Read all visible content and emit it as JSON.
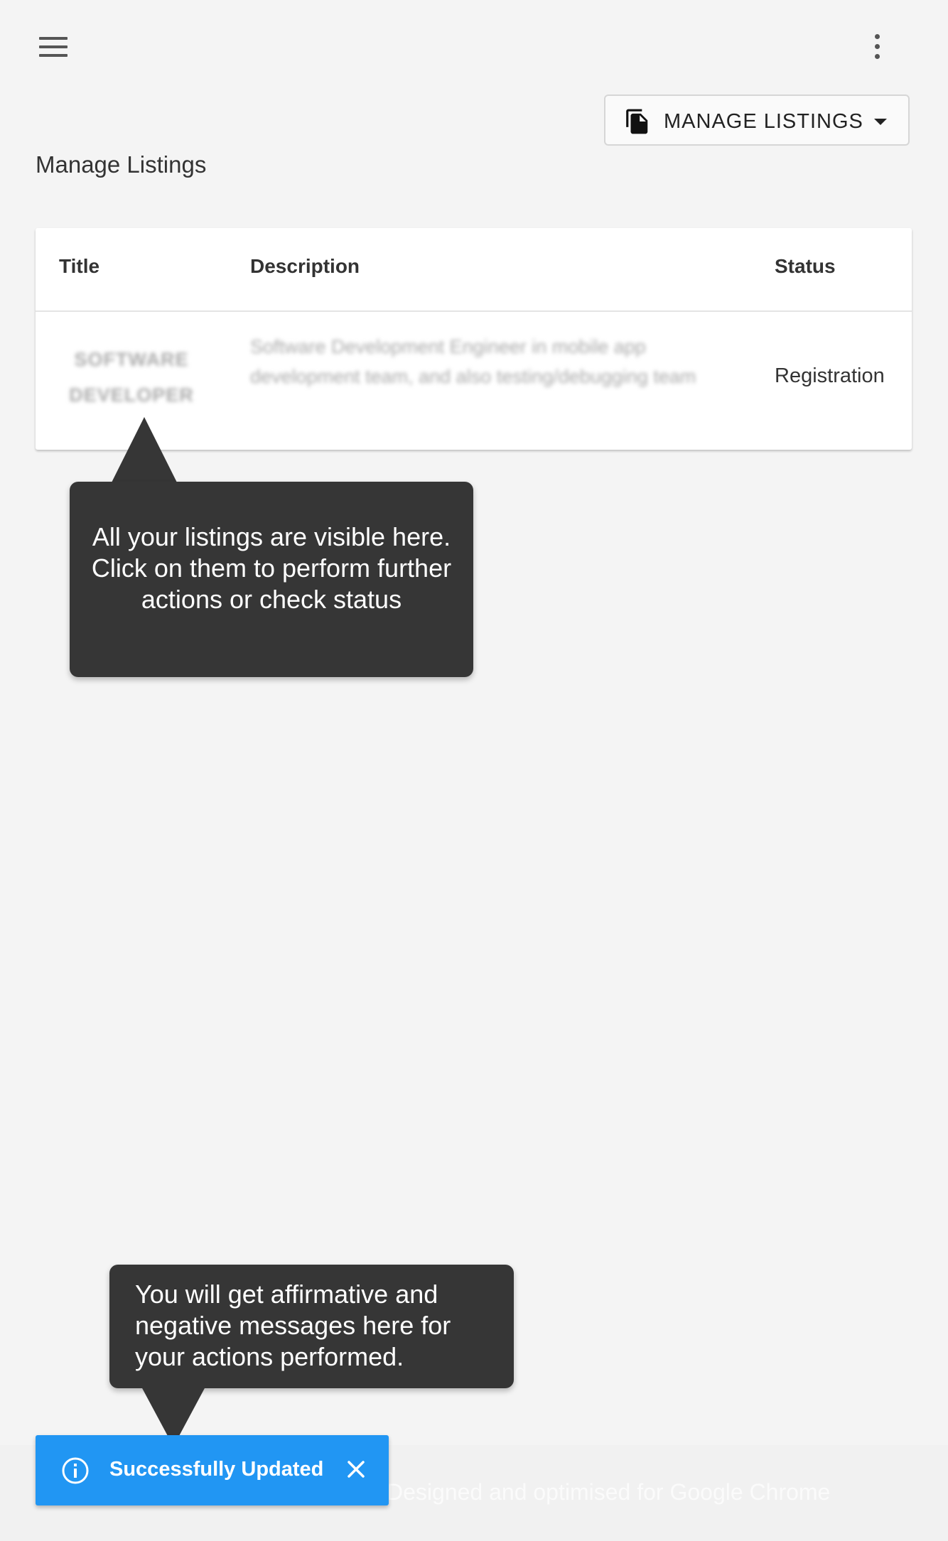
{
  "toolbar": {
    "menu_icon": "hamburger-menu-icon",
    "more_icon": "more-vertical-icon"
  },
  "manage_listings_button": {
    "icon": "copy-documents-icon",
    "label": "MANAGE LISTINGS",
    "dropdown_icon": "caret-down-icon"
  },
  "page": {
    "title": "Manage Listings"
  },
  "table": {
    "columns": [
      "Title",
      "Description",
      "Status"
    ],
    "rows": [
      {
        "title": "SOFTWARE DEVELOPER",
        "description": "Software Development Engineer in mobile app development team, and also testing/debugging team",
        "status": "Registration"
      }
    ]
  },
  "tooltips": {
    "listings": "All your listings are visible here. Click on them to perform further actions or check status",
    "messages": "You will get affirmative and negative messages here for your actions performed."
  },
  "footer": {
    "text": "Designed and optimised for Google Chrome"
  },
  "snackbar": {
    "icon": "info-circle-icon",
    "message": "Successfully Updated",
    "close_icon": "close-icon"
  },
  "colors": {
    "background": "#f4f4f4",
    "snackbar": "#2196f3",
    "tooltip": "#363636"
  }
}
